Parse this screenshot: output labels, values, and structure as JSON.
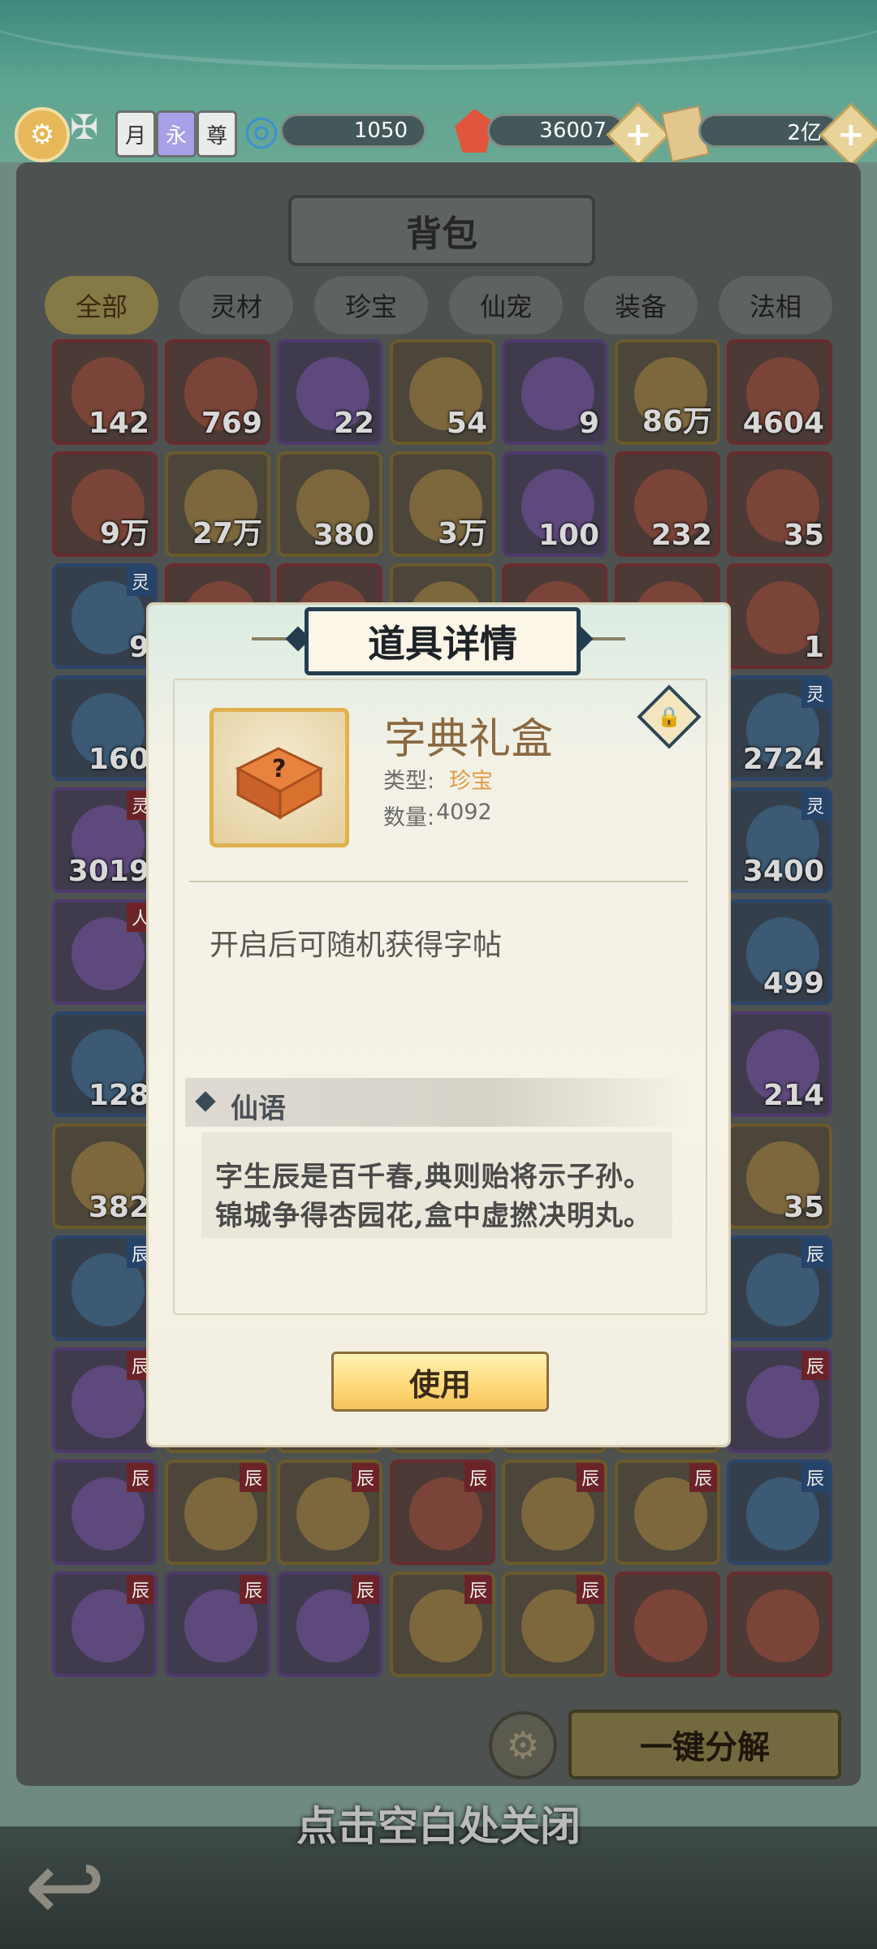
{
  "resources": {
    "badges": [
      "月",
      "永",
      "尊"
    ],
    "spirit_stones": "1050",
    "gems": "36007",
    "scrolls": "2亿"
  },
  "backpack": {
    "title": "背包",
    "tabs": [
      "全部",
      "灵材",
      "珍宝",
      "仙宠",
      "装备",
      "法相"
    ],
    "active_tab": "全部",
    "grid": [
      [
        {
          "count": "142",
          "rarity": "red"
        },
        {
          "count": "769",
          "rarity": "red"
        },
        {
          "count": "22",
          "rarity": "purple"
        },
        {
          "count": "54",
          "rarity": "gold"
        },
        {
          "count": "9",
          "rarity": "purple"
        },
        {
          "count": "86万",
          "rarity": "gold"
        },
        {
          "count": "4604",
          "rarity": "red"
        }
      ],
      [
        {
          "count": "9万",
          "rarity": "red"
        },
        {
          "count": "27万",
          "rarity": "gold"
        },
        {
          "count": "380",
          "rarity": "gold"
        },
        {
          "count": "3万",
          "rarity": "gold"
        },
        {
          "count": "100",
          "rarity": "purple"
        },
        {
          "count": "232",
          "rarity": "red"
        },
        {
          "count": "35",
          "rarity": "red"
        }
      ],
      [
        {
          "count": "9",
          "rarity": "blue",
          "tag": "灵"
        },
        {
          "count": "",
          "rarity": "red"
        },
        {
          "count": "",
          "rarity": "red"
        },
        {
          "count": "",
          "rarity": "gold"
        },
        {
          "count": "",
          "rarity": "red"
        },
        {
          "count": "",
          "rarity": "red"
        },
        {
          "count": "1",
          "rarity": "red"
        }
      ],
      [
        {
          "count": "160",
          "rarity": "blue"
        },
        {
          "count": "",
          "rarity": "gold"
        },
        {
          "count": "",
          "rarity": "gold"
        },
        {
          "count": "",
          "rarity": "gold"
        },
        {
          "count": "",
          "rarity": "gold"
        },
        {
          "count": "",
          "rarity": "gold"
        },
        {
          "count": "2724",
          "rarity": "blue",
          "tag": "灵"
        }
      ],
      [
        {
          "count": "3019",
          "rarity": "purple",
          "tag": "灵"
        },
        {
          "count": "",
          "rarity": "gold"
        },
        {
          "count": "",
          "rarity": "gold"
        },
        {
          "count": "",
          "rarity": "gold"
        },
        {
          "count": "",
          "rarity": "gold"
        },
        {
          "count": "",
          "rarity": "gold"
        },
        {
          "count": "3400",
          "rarity": "blue",
          "tag": "灵"
        }
      ],
      [
        {
          "count": "",
          "rarity": "purple",
          "tag": "人"
        },
        {
          "count": "",
          "rarity": "gold"
        },
        {
          "count": "",
          "rarity": "gold"
        },
        {
          "count": "",
          "rarity": "gold"
        },
        {
          "count": "",
          "rarity": "gold"
        },
        {
          "count": "",
          "rarity": "gold"
        },
        {
          "count": "499",
          "rarity": "blue"
        }
      ],
      [
        {
          "count": "128",
          "rarity": "blue"
        },
        {
          "count": "",
          "rarity": "gold"
        },
        {
          "count": "",
          "rarity": "gold"
        },
        {
          "count": "",
          "rarity": "gold"
        },
        {
          "count": "",
          "rarity": "gold"
        },
        {
          "count": "",
          "rarity": "gold"
        },
        {
          "count": "214",
          "rarity": "purple"
        }
      ],
      [
        {
          "count": "382",
          "rarity": "gold"
        },
        {
          "count": "",
          "rarity": "gold"
        },
        {
          "count": "",
          "rarity": "gold"
        },
        {
          "count": "",
          "rarity": "gold"
        },
        {
          "count": "",
          "rarity": "gold"
        },
        {
          "count": "",
          "rarity": "gold"
        },
        {
          "count": "35",
          "rarity": "gold"
        }
      ],
      [
        {
          "count": "",
          "rarity": "blue",
          "tag": "辰"
        },
        {
          "count": "",
          "rarity": "gold"
        },
        {
          "count": "",
          "rarity": "gold"
        },
        {
          "count": "",
          "rarity": "gold"
        },
        {
          "count": "",
          "rarity": "gold"
        },
        {
          "count": "",
          "rarity": "gold"
        },
        {
          "count": "",
          "rarity": "blue",
          "tag": "辰"
        }
      ],
      [
        {
          "count": "",
          "rarity": "purple",
          "tag": "辰"
        },
        {
          "count": "",
          "rarity": "gold"
        },
        {
          "count": "",
          "rarity": "gold"
        },
        {
          "count": "",
          "rarity": "gold"
        },
        {
          "count": "",
          "rarity": "gold"
        },
        {
          "count": "",
          "rarity": "gold"
        },
        {
          "count": "",
          "rarity": "purple",
          "tag": "辰"
        }
      ],
      [
        {
          "count": "",
          "rarity": "purple",
          "tag": "辰"
        },
        {
          "count": "",
          "rarity": "gold",
          "tag": "辰"
        },
        {
          "count": "",
          "rarity": "gold",
          "tag": "辰"
        },
        {
          "count": "",
          "rarity": "red",
          "tag": "辰"
        },
        {
          "count": "",
          "rarity": "gold",
          "tag": "辰"
        },
        {
          "count": "",
          "rarity": "gold",
          "tag": "辰"
        },
        {
          "count": "",
          "rarity": "blue",
          "tag": "辰"
        }
      ],
      [
        {
          "count": "",
          "rarity": "purple",
          "tag": "辰"
        },
        {
          "count": "",
          "rarity": "purple",
          "tag": "辰"
        },
        {
          "count": "",
          "rarity": "purple",
          "tag": "辰"
        },
        {
          "count": "",
          "rarity": "gold",
          "tag": "辰"
        },
        {
          "count": "",
          "rarity": "gold",
          "tag": "辰"
        },
        {
          "count": "",
          "rarity": "red"
        },
        {
          "count": "",
          "rarity": "red"
        }
      ]
    ],
    "decompose_label": "一键分解",
    "close_hint": "点击空白处关闭"
  },
  "modal": {
    "title": "道具详情",
    "item_name": "字典礼盒",
    "type_label": "类型:",
    "type_value": "珍宝",
    "count_label": "数量:",
    "count_value": "4092",
    "description": "开启后可随机获得字帖",
    "section_title": "仙语",
    "poem_line1": "字生辰是百千春,典则贻将示子孙。",
    "poem_line2": "锦城争得杏园花,盒中虚撚决明丸。",
    "use_label": "使用"
  },
  "colors": {
    "rarity_red": "#6a2b2f",
    "rarity_gold": "#6b5a2a",
    "rarity_purple": "#4d3a6b",
    "rarity_blue": "#2b456b",
    "type_accent": "#e19a45"
  }
}
